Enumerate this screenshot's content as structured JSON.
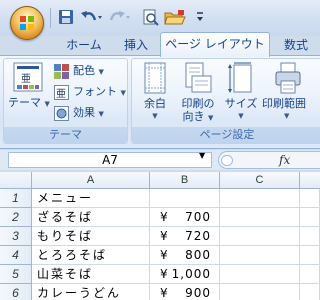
{
  "quick_access": {
    "save_icon": "save-icon",
    "undo_icon": "undo-icon",
    "redo_icon": "redo-icon",
    "print_preview_icon": "print-preview-icon",
    "open_icon": "open-folder-icon",
    "customize_icon": "customize-dropdown-icon"
  },
  "tabs": [
    {
      "label": "ホーム"
    },
    {
      "label": "挿入"
    },
    {
      "label": "ページ レイアウト",
      "active": true
    },
    {
      "label": "数式"
    }
  ],
  "ribbon": {
    "theme_group": {
      "label": "テーマ",
      "theme_button": "テーマ",
      "colors": "配色",
      "fonts": "フォント",
      "effects": "効果"
    },
    "page_setup_group": {
      "label": "ページ設定",
      "margins": "余白",
      "orientation_line1": "印刷の",
      "orientation_line2": "向き",
      "size": "サイズ",
      "print_area": "印刷範囲"
    }
  },
  "formula_bar": {
    "name_box": "A7",
    "fx_label": "fx"
  },
  "sheet": {
    "columns": [
      "A",
      "B",
      "C"
    ],
    "rows": [
      {
        "num": "1",
        "a": "メニュー",
        "yen": "",
        "amount": ""
      },
      {
        "num": "2",
        "a": "ざるそば",
        "yen": "¥",
        "amount": "700"
      },
      {
        "num": "3",
        "a": "もりそば",
        "yen": "¥",
        "amount": "720"
      },
      {
        "num": "4",
        "a": "とろろそば",
        "yen": "¥",
        "amount": "800"
      },
      {
        "num": "5",
        "a": "山菜そば",
        "yen": "¥",
        "amount": "1,000"
      },
      {
        "num": "6",
        "a": "カレーうどん",
        "yen": "¥",
        "amount": "900"
      }
    ]
  }
}
